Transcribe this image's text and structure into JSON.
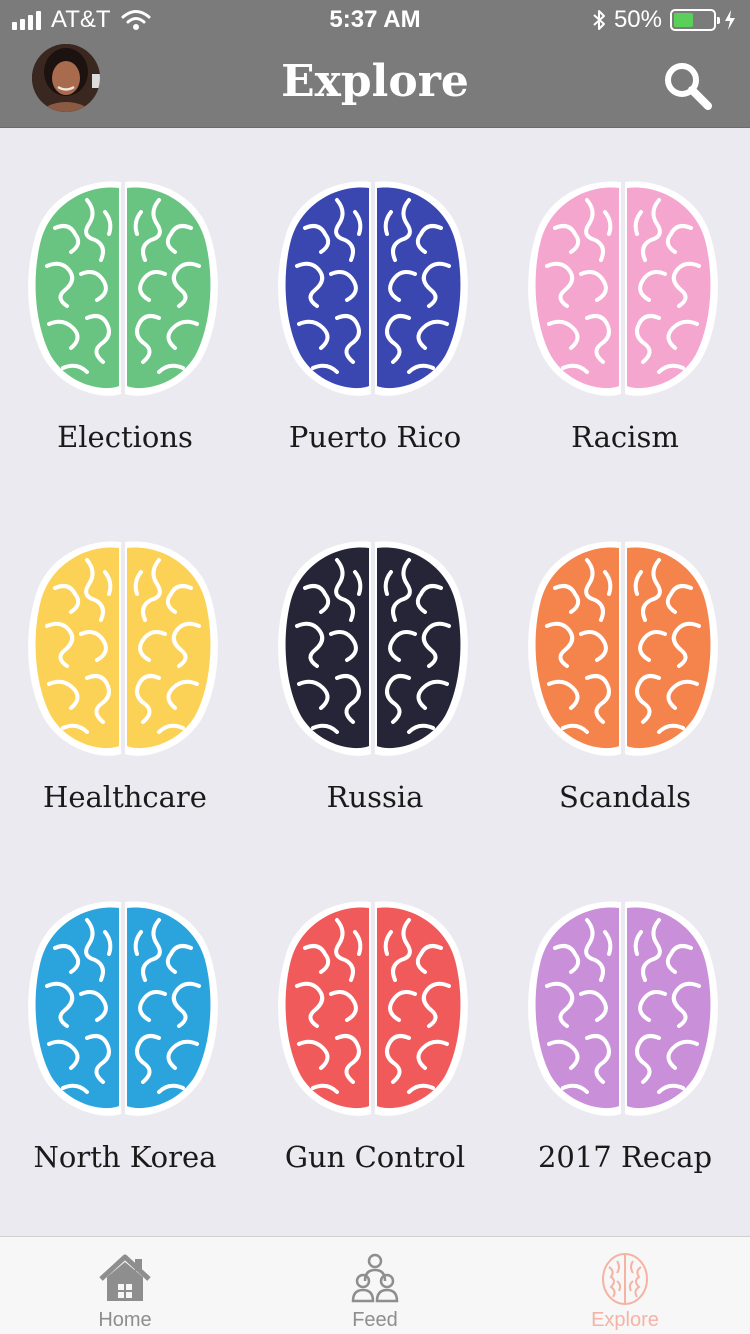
{
  "status_bar": {
    "carrier": "AT&T",
    "time": "5:37 AM",
    "battery_percent": "50%",
    "battery_level": 0.5
  },
  "header": {
    "title": "Explore",
    "search_icon": "search-icon",
    "avatar": "user-avatar"
  },
  "topics": [
    {
      "label": "Elections",
      "color": "#69c482"
    },
    {
      "label": "Puerto Rico",
      "color": "#3a47b0"
    },
    {
      "label": "Racism",
      "color": "#f4a6cf"
    },
    {
      "label": "Healthcare",
      "color": "#fcd256"
    },
    {
      "label": "Russia",
      "color": "#252537"
    },
    {
      "label": "Scandals",
      "color": "#f4834c"
    },
    {
      "label": "North Korea",
      "color": "#2ba4dd"
    },
    {
      "label": "Gun Control",
      "color": "#f05a5a"
    },
    {
      "label": "2017 Recap",
      "color": "#c98fd8"
    }
  ],
  "tabbar": {
    "items": [
      {
        "label": "Home",
        "icon": "home-icon"
      },
      {
        "label": "Feed",
        "icon": "people-icon"
      },
      {
        "label": "Explore",
        "icon": "brain-icon",
        "active": true
      }
    ],
    "active_color": "#f5b3a4",
    "inactive_color": "#8e8e8e"
  }
}
